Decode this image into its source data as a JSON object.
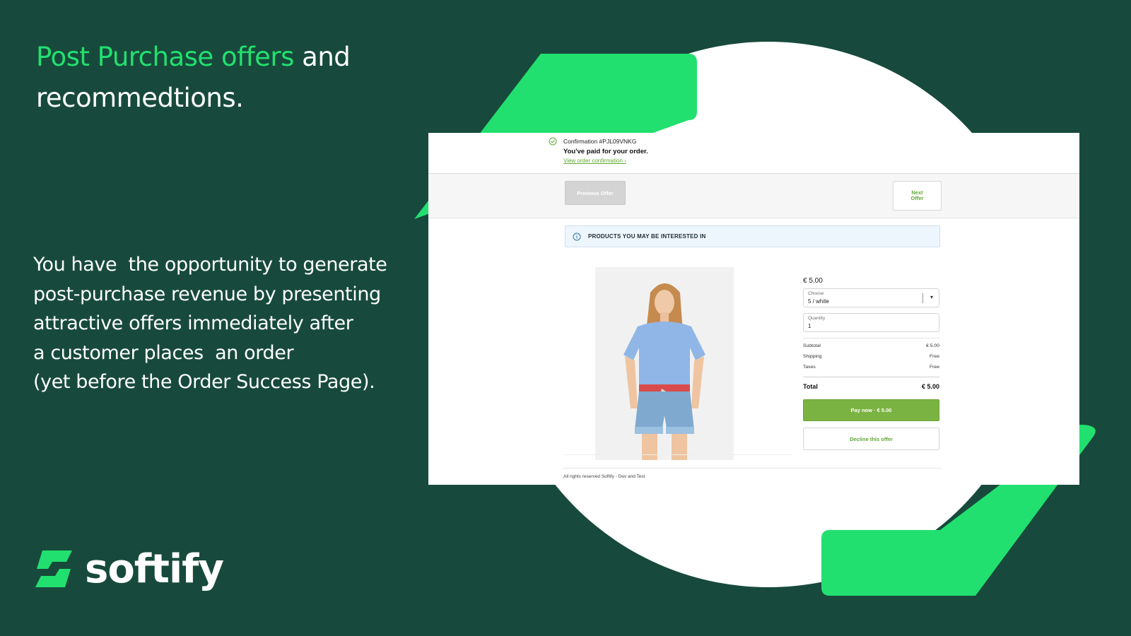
{
  "headline": {
    "highlight": "Post Purchase offers",
    "rest_line1": " and",
    "line2": "recommedtions."
  },
  "body": {
    "lines": [
      "You have  the opportunity to generate",
      "post-purchase revenue by presenting",
      "attractive offers immediately after",
      "a customer places  an order",
      "(yet before the Order Success Page)."
    ]
  },
  "brand": {
    "name": "softify",
    "logo_icon": "softify-s-logo"
  },
  "colors": {
    "background": "#174a3c",
    "accent": "#22e06f",
    "pay_button": "#7bb342",
    "link": "#5fa832"
  },
  "screenshot": {
    "confirmation": {
      "icon": "check-circle-icon",
      "number": "Confirmation #PJL09VNKG",
      "paid": "You've paid for your order.",
      "link": "View order confirmation ›"
    },
    "nav": {
      "previous": "Previous Offer",
      "next_line1": "Next",
      "next_line2": "Offer"
    },
    "banner": {
      "icon": "info-icon",
      "text": "PRODUCTS YOU MAY BE INTERESTED IN"
    },
    "product": {
      "image": "woman in blue t-shirt and denim shorts",
      "price": "€ 5.00",
      "choose_label": "Choose",
      "choose_value": "5 / white",
      "quantity_label": "Quantity",
      "quantity_value": "1"
    },
    "summary": {
      "subtotal_label": "Subtotal",
      "subtotal_value": "€ 5.00",
      "shipping_label": "Shipping",
      "shipping_value": "Free",
      "taxes_label": "Taxes",
      "taxes_value": "Free",
      "total_label": "Total",
      "total_value": "€ 5.00"
    },
    "pay_button": "Pay now · € 5.00",
    "decline_button": "Decline this offer",
    "footer": "All rights reserved Softify - Dev and Test"
  }
}
